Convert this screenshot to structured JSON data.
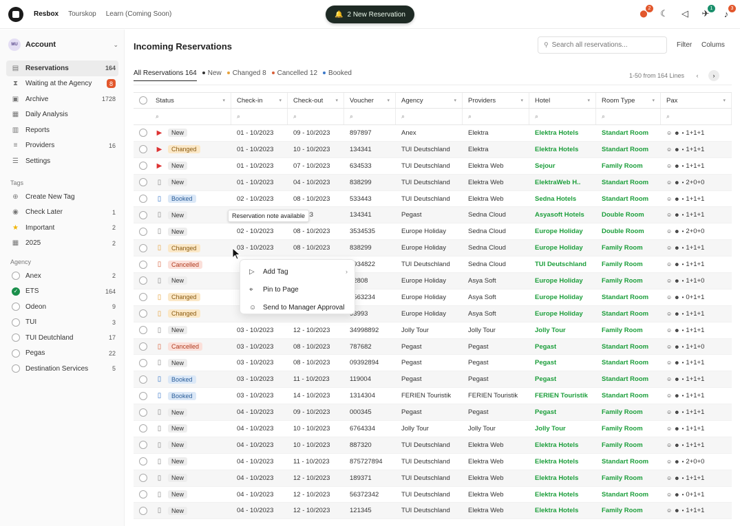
{
  "topbar": {
    "nav": [
      {
        "label": "Resbox",
        "active": true
      },
      {
        "label": "Tourskop",
        "active": false
      },
      {
        "label": "Learn (Coming Soon)",
        "active": false
      }
    ],
    "notification_pill": "2 New Reservation",
    "icons": [
      {
        "name": "apps-icon",
        "badge": "2",
        "badge_color": "#e2572c"
      },
      {
        "name": "moon-icon",
        "badge": null
      },
      {
        "name": "megaphone-icon",
        "badge": null
      },
      {
        "name": "rocket-icon",
        "badge": "1",
        "badge_color": "#1a8f6b"
      },
      {
        "name": "bell-icon",
        "badge": "3",
        "badge_color": "#e2572c"
      }
    ]
  },
  "sidebar": {
    "account": {
      "initials": "MU",
      "label": "Account"
    },
    "main_items": [
      {
        "icon": "inbox-icon",
        "label": "Reservations",
        "count": "164",
        "active": true
      },
      {
        "icon": "hourglass-icon",
        "label": "Waiting at the Agency",
        "count": "8",
        "badge": true
      },
      {
        "icon": "archive-icon",
        "label": "Archive",
        "count": "1728"
      },
      {
        "icon": "chart-icon",
        "label": "Daily Analysis",
        "count": ""
      },
      {
        "icon": "report-icon",
        "label": "Reports",
        "count": ""
      },
      {
        "icon": "layers-icon",
        "label": "Providers",
        "count": "16"
      },
      {
        "icon": "settings-icon",
        "label": "Settings",
        "count": ""
      }
    ],
    "tags_heading": "Tags",
    "tags": [
      {
        "icon": "plus-icon",
        "label": "Create New Tag",
        "count": ""
      },
      {
        "icon": "eyes-icon",
        "label": "Check Later",
        "count": "1"
      },
      {
        "icon": "star-icon",
        "label": "Important",
        "count": "2"
      },
      {
        "icon": "calendar-icon",
        "label": "2025",
        "count": "2"
      }
    ],
    "agency_heading": "Agency",
    "agencies": [
      {
        "label": "Anex",
        "count": "2",
        "checked": false
      },
      {
        "label": "ETS",
        "count": "164",
        "checked": true
      },
      {
        "label": "Odeon",
        "count": "9",
        "checked": false
      },
      {
        "label": "TUI",
        "count": "3",
        "checked": false
      },
      {
        "label": "TUI Deutchland",
        "count": "17",
        "checked": false
      },
      {
        "label": "Pegas",
        "count": "22",
        "checked": false
      },
      {
        "label": "Destination Services",
        "count": "5",
        "checked": false
      }
    ]
  },
  "main": {
    "title": "Incoming Reservations",
    "search_placeholder": "Search all reservations...",
    "filter_label": "Filter",
    "columns_label": "Colums",
    "tabs": [
      {
        "label": "All Reservations 164",
        "active": true,
        "dot": ""
      },
      {
        "label": "New",
        "dot": "#333333"
      },
      {
        "label": "Changed 8",
        "dot": "#e6a23c"
      },
      {
        "label": "Cancelled 12",
        "dot": "#d8603a"
      },
      {
        "label": "Booked",
        "dot": "#3a78c9"
      }
    ],
    "lines_info": "1-50 from 164 Lines",
    "columns": [
      "Status",
      "Check-in",
      "Check-out",
      "Voucher",
      "Agency",
      "Providers",
      "Hotel",
      "Room Type",
      "Pax"
    ],
    "rows": [
      {
        "icon": "pin",
        "status": "New",
        "note": true,
        "checkin": "01 - 10/2023",
        "checkout": "09 - 10/2023",
        "voucher": "897897",
        "agency": "Anex",
        "provider": "Elektra",
        "hotel": "Elektra Hotels",
        "room": "Standart Room",
        "pax": "1+1+1"
      },
      {
        "icon": "pin",
        "status": "Changed",
        "note": true,
        "checkin": "01 - 10/2023",
        "checkout": "10 - 10/2023",
        "voucher": "134341",
        "agency": "TUI Deutschland",
        "provider": "Elektra",
        "hotel": "Elektra Hotels",
        "room": "Standart Room",
        "pax": "1+1+1"
      },
      {
        "icon": "pin",
        "status": "New",
        "note": false,
        "checkin": "01 - 10/2023",
        "checkout": "07 - 10/2023",
        "voucher": "634533",
        "agency": "TUI Deutschland",
        "provider": "Elektra Web",
        "hotel": "Sejour",
        "room": "Family Room",
        "pax": "1+1+1"
      },
      {
        "icon": "doc",
        "status": "New",
        "note": true,
        "checkin": "01 - 10/2023",
        "checkout": "04 - 10/2023",
        "voucher": "838299",
        "agency": "TUI Deutschland",
        "provider": "Elektra Web",
        "hotel": "ElektraWeb H..",
        "room": "Standart Room",
        "pax": "2+0+0"
      },
      {
        "icon": "doc",
        "status": "Booked",
        "note": true,
        "checkin": "02 - 10/2023",
        "checkout": "08 - 10/2023",
        "voucher": "533443",
        "agency": "TUI Deutschland",
        "provider": "Elektra Web",
        "hotel": "Sedna Hotels",
        "room": "Standart Room",
        "pax": "1+1+1"
      },
      {
        "icon": "doc",
        "status": "New",
        "note": true,
        "checkin": "",
        "checkout": "0/2023",
        "voucher": "134341",
        "agency": "Pegast",
        "provider": "Sedna Cloud",
        "hotel": "Asyasoft Hotels",
        "room": "Double Room",
        "pax": "1+1+1"
      },
      {
        "icon": "doc",
        "status": "New",
        "note": false,
        "checkin": "02 - 10/2023",
        "checkout": "08 - 10/2023",
        "voucher": "3534535",
        "agency": "Europe Holiday",
        "provider": "Sedna Cloud",
        "hotel": "Europe Holiday",
        "room": "Double Room",
        "pax": "2+0+0"
      },
      {
        "icon": "doc",
        "status": "Changed",
        "note": true,
        "checkin": "03 - 10/2023",
        "checkout": "08 - 10/2023",
        "voucher": "838299",
        "agency": "Europe Holiday",
        "provider": "Sedna Cloud",
        "hotel": "Europe Holiday",
        "room": "Family Room",
        "pax": "1+1+1"
      },
      {
        "icon": "doc",
        "status": "Cancelled",
        "note": false,
        "checkin": "",
        "checkout": "",
        "voucher": "1934822",
        "agency": "TUI Deutschland",
        "provider": "Sedna Cloud",
        "hotel": "TUI Deutschland",
        "room": "Family Room",
        "pax": "1+1+1"
      },
      {
        "icon": "doc",
        "status": "New",
        "note": true,
        "checkin": "",
        "checkout": "",
        "voucher": "12808",
        "agency": "Europe Holiday",
        "provider": "Asya Soft",
        "hotel": "Europe Holiday",
        "room": "Family Room",
        "pax": "1+1+0"
      },
      {
        "icon": "doc",
        "status": "Changed",
        "note": true,
        "checkin": "",
        "checkout": "",
        "voucher": "3563234",
        "agency": "Europe Holiday",
        "provider": "Asya Soft",
        "hotel": "Europe Holiday",
        "room": "Standart Room",
        "pax": "0+1+1"
      },
      {
        "icon": "doc",
        "status": "Changed",
        "note": true,
        "checkin": "",
        "checkout": "",
        "voucher": "93993",
        "agency": "Europe Holiday",
        "provider": "Asya Soft",
        "hotel": "Europe Holiday",
        "room": "Standart Room",
        "pax": "1+1+1"
      },
      {
        "icon": "doc",
        "status": "New",
        "note": true,
        "checkin": "03 - 10/2023",
        "checkout": "12 - 10/2023",
        "voucher": "34998892",
        "agency": "Jolly Tour",
        "provider": "Jolly Tour",
        "hotel": "Jolly Tour",
        "room": "Family Room",
        "pax": "1+1+1"
      },
      {
        "icon": "doc",
        "status": "Cancelled",
        "note": true,
        "checkin": "03 - 10/2023",
        "checkout": "08 - 10/2023",
        "voucher": "787682",
        "agency": "Pegast",
        "provider": "Pegast",
        "hotel": "Pegast",
        "room": "Standart Room",
        "pax": "1+1+0"
      },
      {
        "icon": "doc",
        "status": "New",
        "note": true,
        "checkin": "03 - 10/2023",
        "checkout": "08 - 10/2023",
        "voucher": "09392894",
        "agency": "Pegast",
        "provider": "Pegast",
        "hotel": "Pegast",
        "room": "Standart Room",
        "pax": "1+1+1"
      },
      {
        "icon": "doc",
        "status": "Booked",
        "note": true,
        "checkin": "03 - 10/2023",
        "checkout": "11 - 10/2023",
        "voucher": "119004",
        "agency": "Pegast",
        "provider": "Pegast",
        "hotel": "Pegast",
        "room": "Standart Room",
        "pax": "1+1+1"
      },
      {
        "icon": "doc",
        "status": "Booked",
        "note": true,
        "checkin": "03 - 10/2023",
        "checkout": "14 - 10/2023",
        "voucher": "1314304",
        "agency": "FERIEN Touristik",
        "provider": "FERIEN Touristik",
        "hotel": "FERIEN Touristik",
        "room": "Standart Room",
        "pax": "1+1+1"
      },
      {
        "icon": "doc",
        "status": "New",
        "note": false,
        "checkin": "04 - 10/2023",
        "checkout": "09 - 10/2023",
        "voucher": "000345",
        "agency": "Pegast",
        "provider": "Pegast",
        "hotel": "Pegast",
        "room": "Family Room",
        "pax": "1+1+1"
      },
      {
        "icon": "doc",
        "status": "New",
        "note": false,
        "checkin": "04 - 10/2023",
        "checkout": "10 - 10/2023",
        "voucher": "6764334",
        "agency": "Jolly Tour",
        "provider": "Jolly Tour",
        "hotel": "Jolly Tour",
        "room": "Family Room",
        "pax": "1+1+1"
      },
      {
        "icon": "doc",
        "status": "New",
        "note": true,
        "checkin": "04 - 10/2023",
        "checkout": "10 - 10/2023",
        "voucher": "887320",
        "agency": "TUI Deutschland",
        "provider": "Elektra Web",
        "hotel": "Elektra Hotels",
        "room": "Family Room",
        "pax": "1+1+1"
      },
      {
        "icon": "doc",
        "status": "New",
        "note": false,
        "checkin": "04 - 10/2023",
        "checkout": "11 - 10/2023",
        "voucher": "875727894",
        "agency": "TUI Deutschland",
        "provider": "Elektra Web",
        "hotel": "Elektra Hotels",
        "room": "Standart Room",
        "pax": "2+0+0"
      },
      {
        "icon": "doc",
        "status": "New",
        "note": true,
        "checkin": "04 - 10/2023",
        "checkout": "12 - 10/2023",
        "voucher": "189371",
        "agency": "TUI Deutschland",
        "provider": "Elektra Web",
        "hotel": "Elektra Hotels",
        "room": "Family Room",
        "pax": "1+1+1"
      },
      {
        "icon": "doc",
        "status": "New",
        "note": true,
        "checkin": "04 - 10/2023",
        "checkout": "12 - 10/2023",
        "voucher": "56372342",
        "agency": "TUI Deutschland",
        "provider": "Elektra Web",
        "hotel": "Elektra Hotels",
        "room": "Standart Room",
        "pax": "0+1+1"
      },
      {
        "icon": "doc",
        "status": "New",
        "note": true,
        "checkin": "04 - 10/2023",
        "checkout": "12 - 10/2023",
        "voucher": "121345",
        "agency": "TUI Deutschland",
        "provider": "Elektra Web",
        "hotel": "Elektra Hotels",
        "room": "Family Room",
        "pax": "1+1+1"
      }
    ]
  },
  "tooltip": "Reservation note available",
  "context_menu": [
    {
      "icon": "tag-icon",
      "label": "Add Tag",
      "submenu": true
    },
    {
      "icon": "pin-icon",
      "label": "Pin to Page",
      "submenu": false
    },
    {
      "icon": "user-approval-icon",
      "label": "Send to Manager Approval",
      "submenu": false
    }
  ]
}
